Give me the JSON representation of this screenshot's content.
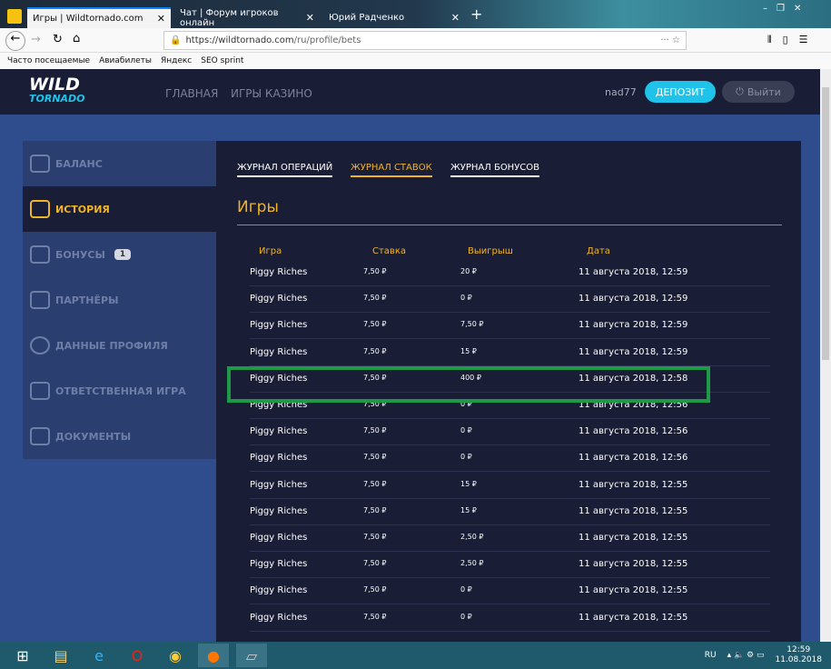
{
  "browser": {
    "tabs": [
      {
        "title": "Игры | Wildtornado.com",
        "active": true
      },
      {
        "title": "Чат | Форум игроков онлайн"
      },
      {
        "title": "Юрий Радченко"
      }
    ],
    "url_host": "https://wildtornado.com",
    "url_path": "/ru/profile/bets",
    "bookmarks": [
      "Часто посещаемые",
      "Авиабилеты",
      "Яндекс",
      "SEO sprint"
    ]
  },
  "site": {
    "logo_top": "WILD",
    "logo_bottom": "TORNADO",
    "nav": [
      "ГЛАВНАЯ",
      "ИГРЫ КАЗИНО"
    ],
    "username": "nad77",
    "deposit": "ДЕПОЗИТ",
    "logout": "Выйти"
  },
  "sidebar": [
    {
      "label": "БАЛАНС"
    },
    {
      "label": "ИСТОРИЯ",
      "active": true
    },
    {
      "label": "БОНУСЫ",
      "badge": "1"
    },
    {
      "label": "ПАРТНЁРЫ"
    },
    {
      "label": "ДАННЫЕ ПРОФИЛЯ"
    },
    {
      "label": "ОТВЕТСТВЕННАЯ ИГРА"
    },
    {
      "label": "ДОКУМЕНТЫ"
    }
  ],
  "journal_tabs": [
    "ЖУРНАЛ ОПЕРАЦИЙ",
    "ЖУРНАЛ СТАВОК",
    "ЖУРНАЛ БОНУСОВ"
  ],
  "section_title": "Игры",
  "columns": [
    "Игра",
    "Ставка",
    "Выигрыш",
    "Дата"
  ],
  "currency": "₽",
  "rows": [
    [
      "Piggy Riches",
      "7,50",
      "20",
      "11 августа 2018, 12:59"
    ],
    [
      "Piggy Riches",
      "7,50",
      "0",
      "11 августа 2018, 12:59"
    ],
    [
      "Piggy Riches",
      "7,50",
      "7,50",
      "11 августа 2018, 12:59"
    ],
    [
      "Piggy Riches",
      "7,50",
      "15",
      "11 августа 2018, 12:59"
    ],
    [
      "Piggy Riches",
      "7,50",
      "400",
      "11 августа 2018, 12:58"
    ],
    [
      "Piggy Riches",
      "7,50",
      "0",
      "11 августа 2018, 12:56"
    ],
    [
      "Piggy Riches",
      "7,50",
      "0",
      "11 августа 2018, 12:56"
    ],
    [
      "Piggy Riches",
      "7,50",
      "0",
      "11 августа 2018, 12:56"
    ],
    [
      "Piggy Riches",
      "7,50",
      "15",
      "11 августа 2018, 12:55"
    ],
    [
      "Piggy Riches",
      "7,50",
      "15",
      "11 августа 2018, 12:55"
    ],
    [
      "Piggy Riches",
      "7,50",
      "2,50",
      "11 августа 2018, 12:55"
    ],
    [
      "Piggy Riches",
      "7,50",
      "2,50",
      "11 августа 2018, 12:55"
    ],
    [
      "Piggy Riches",
      "7,50",
      "0",
      "11 августа 2018, 12:55"
    ],
    [
      "Piggy Riches",
      "7,50",
      "0",
      "11 августа 2018, 12:55"
    ]
  ],
  "highlight_row": 4,
  "taskbar": {
    "lang": "RU",
    "time": "12:59",
    "date": "11.08.2018"
  }
}
